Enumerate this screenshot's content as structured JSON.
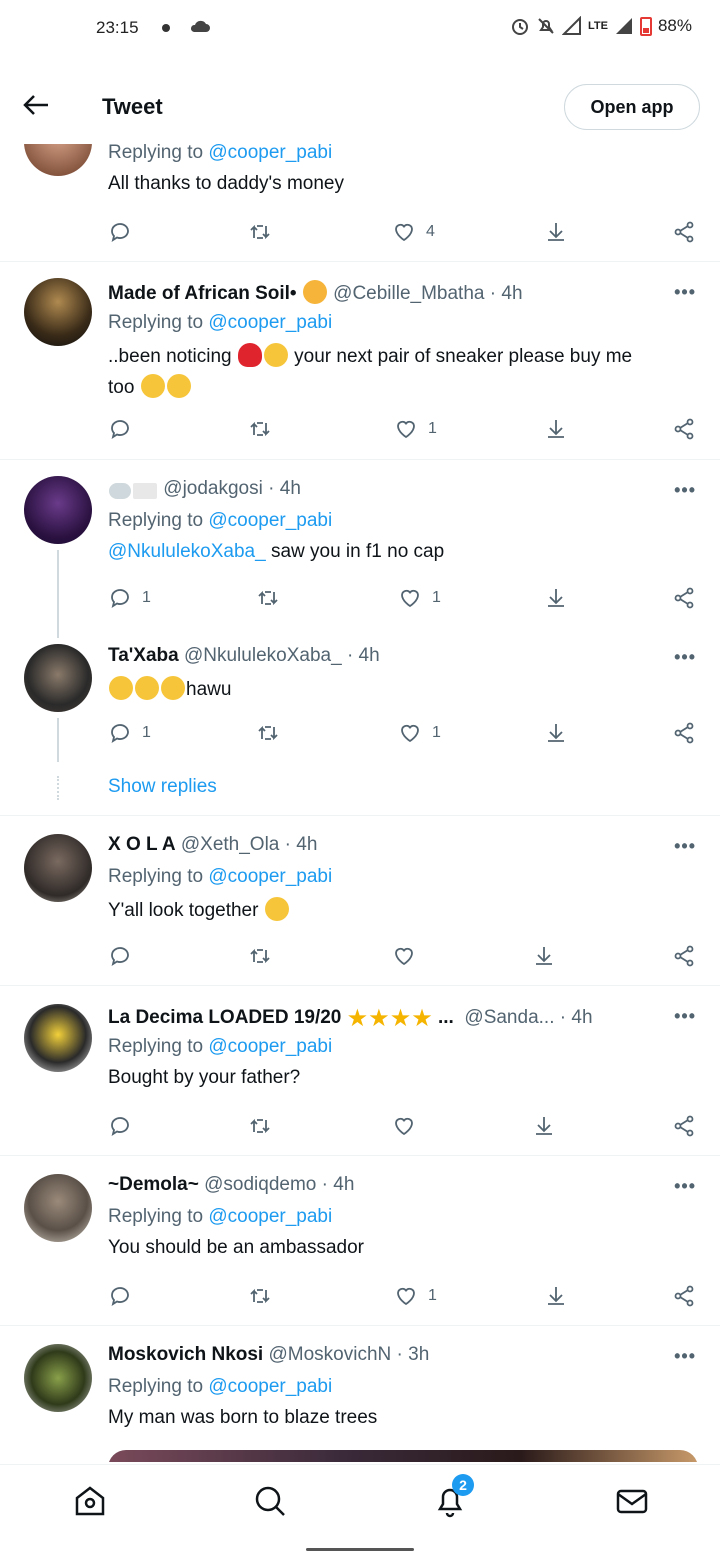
{
  "status": {
    "time": "23:15",
    "network": "LTE",
    "battery": "88%"
  },
  "header": {
    "title": "Tweet",
    "open_app": "Open app"
  },
  "tweets": [
    {
      "reply_prefix": "Replying to ",
      "reply_to": "@cooper_pabi",
      "text": "All thanks to daddy's money",
      "likes": "4"
    },
    {
      "display_name": "Made of African Soil•",
      "handle": "@Cebille_Mbatha",
      "time": "· 4h",
      "reply_prefix": "Replying to ",
      "reply_to": "@cooper_pabi",
      "text_a": "..been noticing ",
      "text_b": "  your next pair of sneaker please buy me",
      "text_c": "too ",
      "likes": "1"
    },
    {
      "handle": "@jodakgosi",
      "time": "· 4h",
      "reply_prefix": "Replying to ",
      "reply_to": "@cooper_pabi",
      "mention": "@NkululekoXaba_",
      "text": " saw you in f1 no cap",
      "replies": "1",
      "likes": "1"
    },
    {
      "display_name": "Ta'Xaba",
      "handle": "@NkululekoXaba_",
      "time": "· 4h",
      "text": "hawu",
      "replies": "1",
      "likes": "1"
    },
    {
      "display_name": "X O L A",
      "handle": "@Xeth_Ola",
      "time": "· 4h",
      "reply_prefix": "Replying to ",
      "reply_to": "@cooper_pabi",
      "text": "Y'all look together "
    },
    {
      "display_name": "La Decima LOADED 19/20",
      "ellipsis": "...",
      "handle": "@Sanda...",
      "time": "· 4h",
      "reply_prefix": "Replying to ",
      "reply_to": "@cooper_pabi",
      "text": "Bought by your father?"
    },
    {
      "display_name": "~Demola~",
      "handle": "@sodiqdemo",
      "time": "· 4h",
      "reply_prefix": "Replying to ",
      "reply_to": "@cooper_pabi",
      "text": "You should be an ambassador",
      "likes": "1"
    },
    {
      "display_name": "Moskovich Nkosi",
      "handle": "@MoskovichN",
      "time": "· 3h",
      "reply_prefix": "Replying to ",
      "reply_to": "@cooper_pabi",
      "text": "My man was born to blaze trees"
    }
  ],
  "show_replies": "Show replies",
  "more_label": "•••",
  "nav": {
    "notifications_badge": "2"
  }
}
